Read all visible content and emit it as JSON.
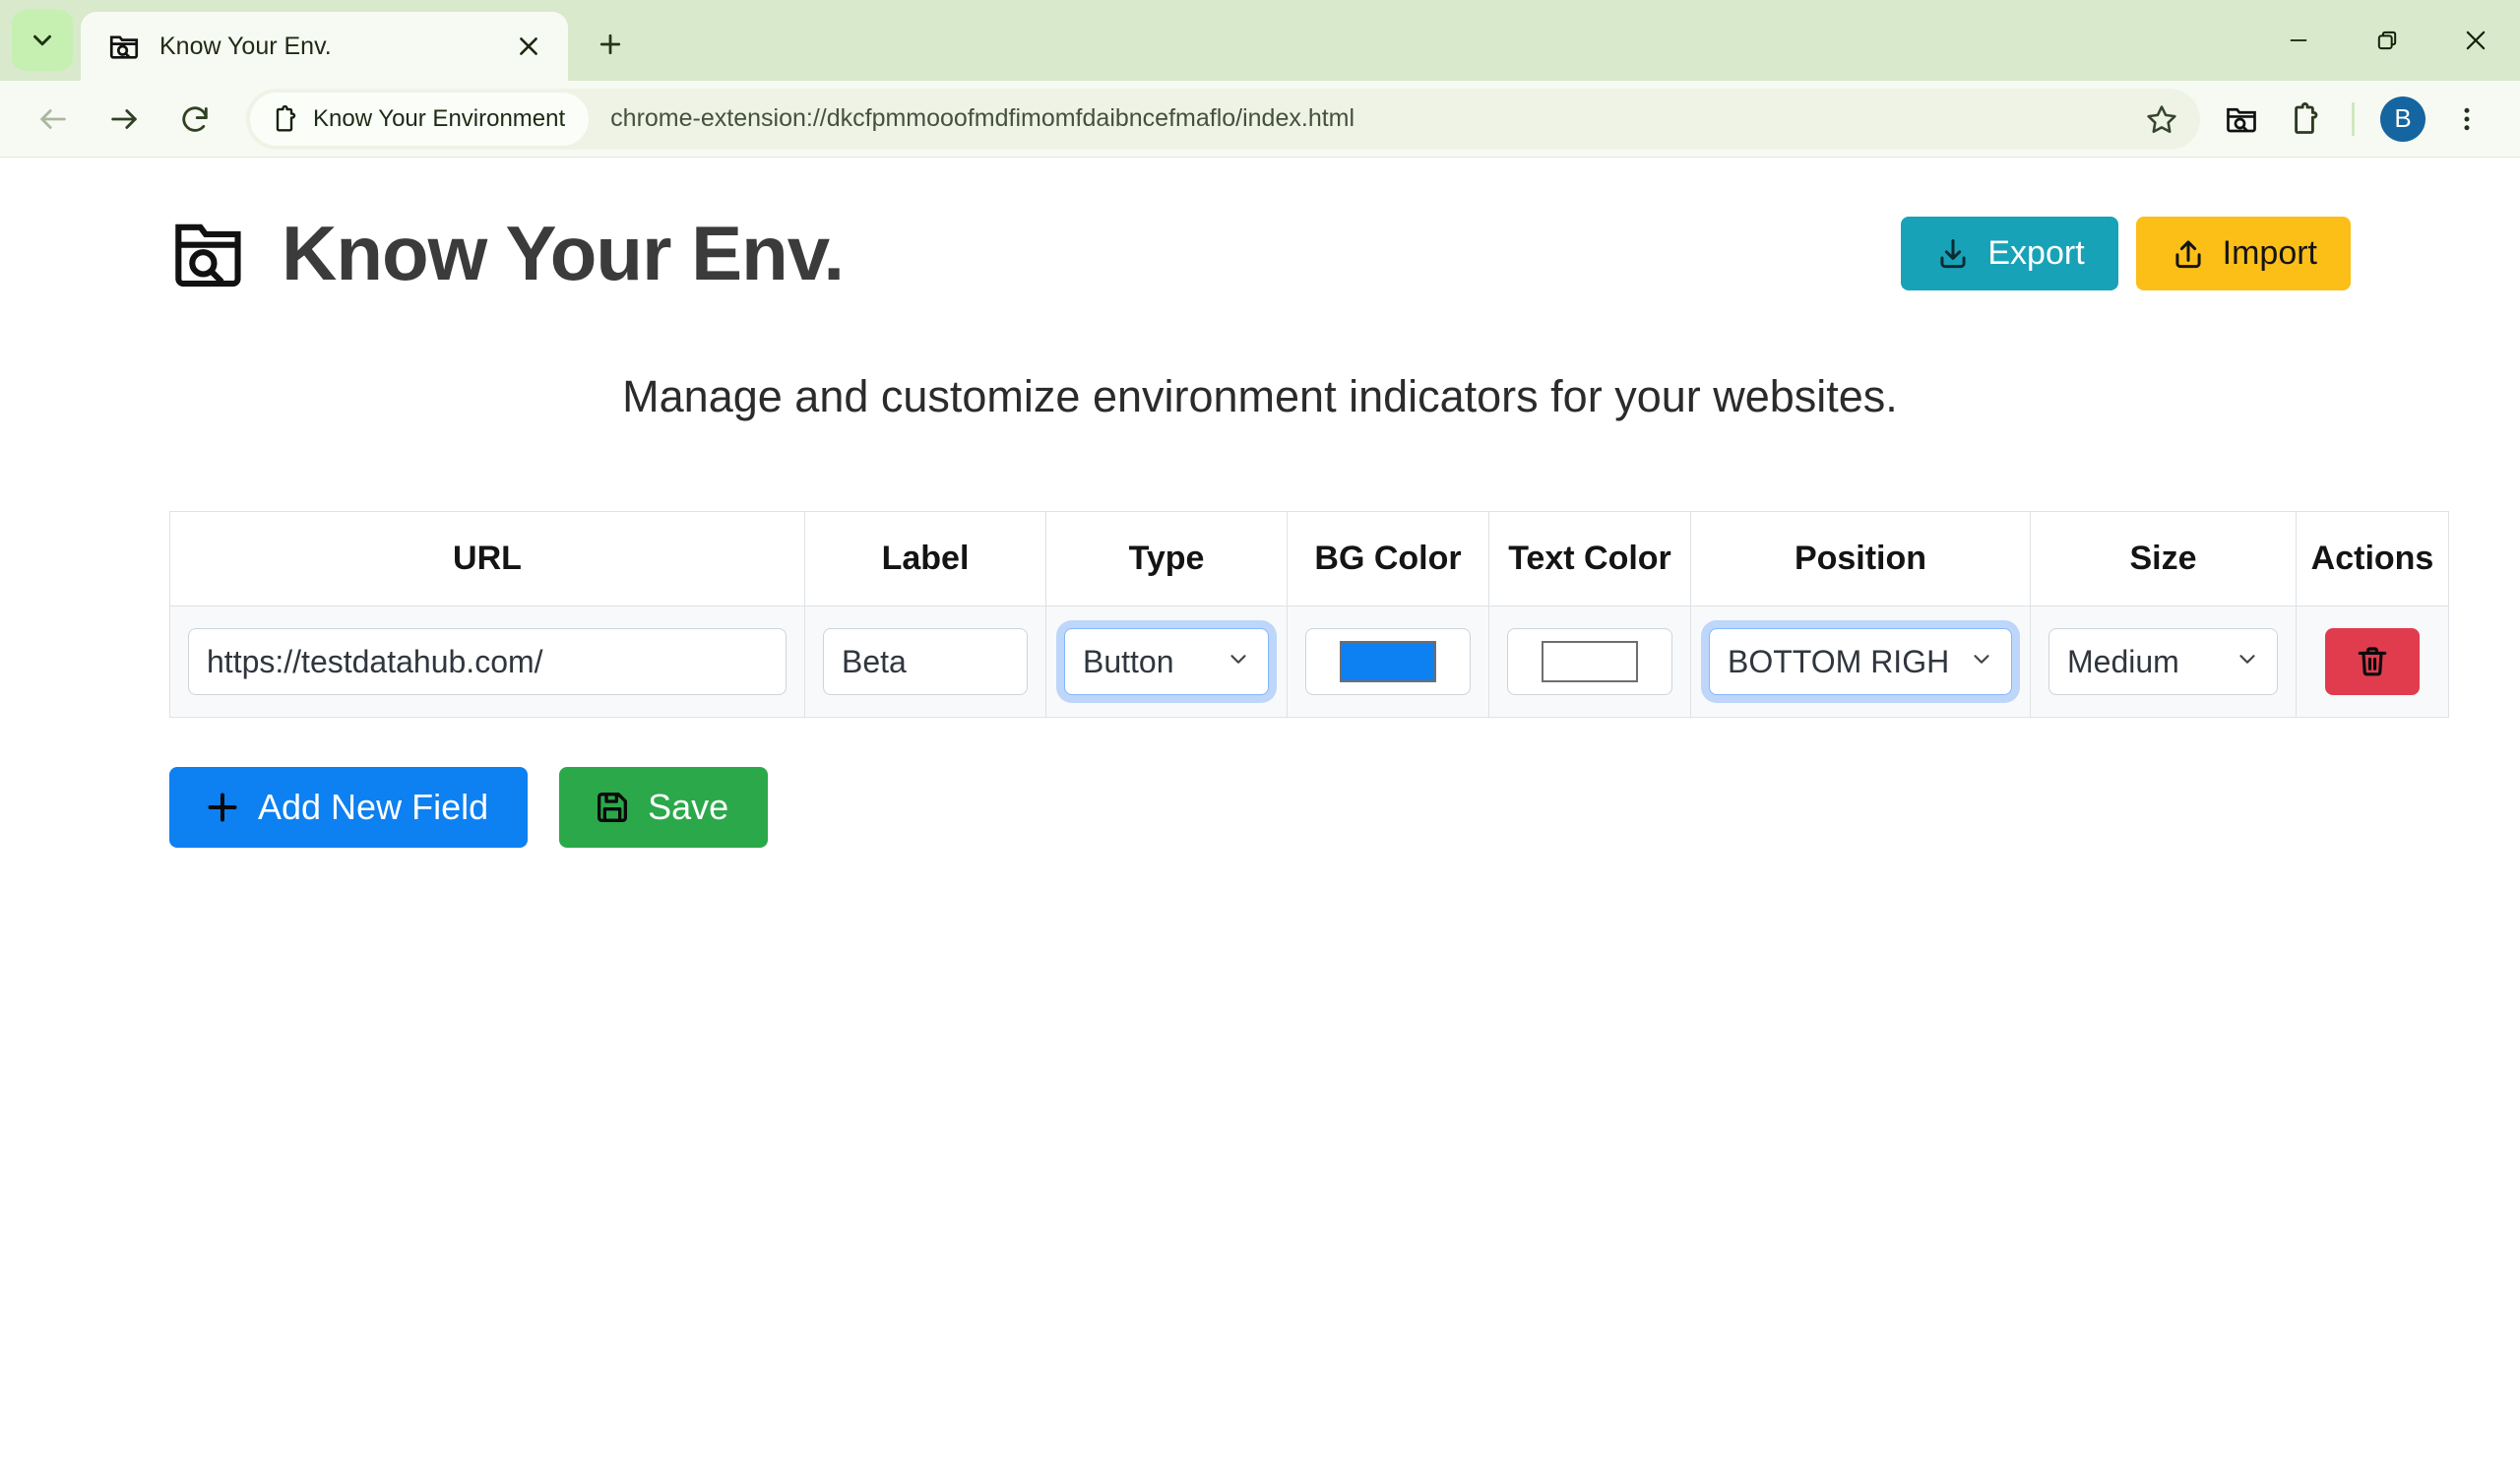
{
  "browser": {
    "tab": {
      "title": "Know Your Env.",
      "favicon": "folder-search-icon",
      "close": "close-icon"
    },
    "new_tab_label": "+",
    "window_controls": {
      "minimize": "minimize-icon",
      "maximize": "restore-icon",
      "close": "window-close-icon"
    },
    "nav": {
      "back": "back-arrow-icon",
      "forward": "forward-arrow-icon",
      "reload": "reload-icon"
    },
    "omnibox": {
      "extension_chip_label": "Know Your Environment",
      "extension_chip_icon": "puzzle-piece-icon",
      "url": "chrome-extension://dkcfpmmooofmdfimomfdaibncefmaflo/index.html",
      "bookmark": "star-icon"
    },
    "toolbar_icons": {
      "extension_app": "folder-search-icon",
      "extensions": "puzzle-piece-icon",
      "menu": "three-dot-menu-icon"
    },
    "profile": {
      "initial": "B"
    },
    "colors": {
      "tabstrip_bg": "#d9e9cb",
      "toolbar_bg": "#f7faf3",
      "active_tab_bg": "#f7faf3",
      "omnibox_bg": "#eef3e6",
      "avatar_bg": "#1565a0"
    }
  },
  "app": {
    "logo_icon": "folder-search-icon",
    "title": "Know Your Env.",
    "subtitle": "Manage and customize environment indicators for your websites.",
    "header_buttons": {
      "export": {
        "label": "Export",
        "icon": "download-icon",
        "bg": "#18a2b8",
        "fg": "#ffffff"
      },
      "import": {
        "label": "Import",
        "icon": "upload-icon",
        "bg": "#fcbf18",
        "fg": "#141414"
      }
    },
    "table": {
      "headers": [
        "URL",
        "Label",
        "Type",
        "BG Color",
        "Text Color",
        "Position",
        "Size",
        "Actions"
      ],
      "rows": [
        {
          "url": "https://testdatahub.com/",
          "label": "Beta",
          "type": "Button",
          "bg_color": "#0d80f2",
          "text_color": "#ffffff",
          "position": "BOTTOM RIGH",
          "size": "Medium",
          "delete_icon": "trash-icon",
          "delete_bg": "#e03c4e"
        }
      ]
    },
    "footer_buttons": {
      "add": {
        "label": "Add New Field",
        "icon": "plus-icon",
        "bg": "#0d80f2"
      },
      "save": {
        "label": "Save",
        "icon": "floppy-disk-icon",
        "bg": "#2ba84a"
      }
    }
  }
}
